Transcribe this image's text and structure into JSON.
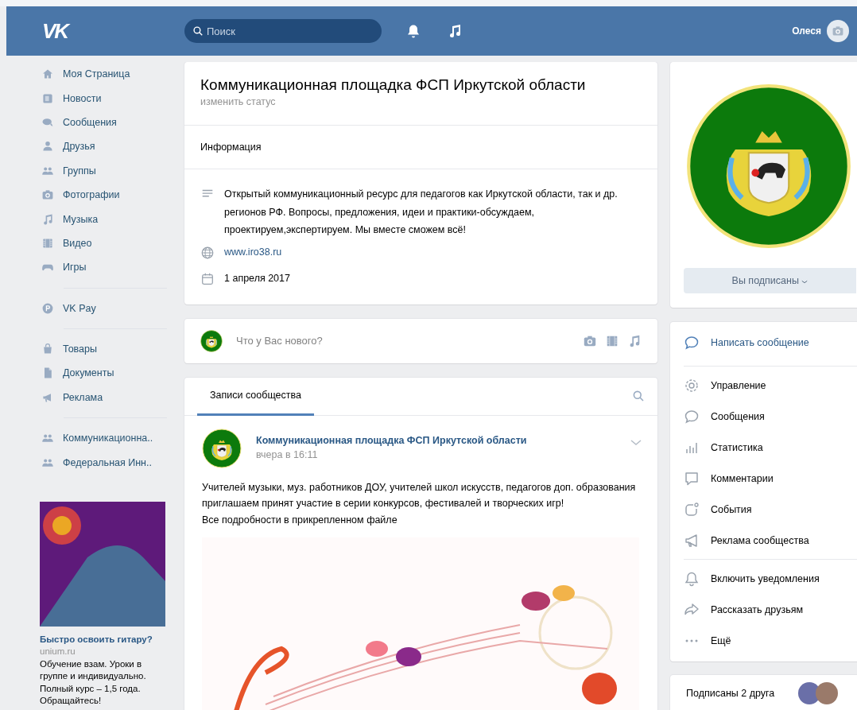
{
  "header": {
    "logo": "VK",
    "search": {
      "placeholder": "Поиск"
    },
    "user": "Олеся"
  },
  "sidebar": {
    "groups": [
      {
        "items": [
          {
            "label": "Моя Страница"
          },
          {
            "label": "Новости"
          },
          {
            "label": "Сообщения"
          },
          {
            "label": "Друзья"
          },
          {
            "label": "Группы"
          },
          {
            "label": "Фотографии"
          },
          {
            "label": "Музыка"
          },
          {
            "label": "Видео"
          },
          {
            "label": "Игры"
          }
        ]
      },
      {
        "items": [
          {
            "label": "VK Pay"
          }
        ]
      },
      {
        "items": [
          {
            "label": "Товары"
          },
          {
            "label": "Документы"
          },
          {
            "label": "Реклама"
          }
        ]
      },
      {
        "items": [
          {
            "label": "Коммуникационна.."
          },
          {
            "label": "Федеральная Инн.."
          }
        ]
      }
    ]
  },
  "ad": {
    "title": "Быстро освоить гитару?",
    "domain": "unium.ru",
    "text": "Обучение взам. Уроки в группе и индивидуально. Полный курс – 1,5 года. Обращайтесь!"
  },
  "community": {
    "title": "Коммуникационная площадка ФСП Иркутской области",
    "status": "изменить статус",
    "info_heading": "Информация",
    "description": "Открытый коммуникационный ресурс для педагогов как Иркутской области, так и др. регионов РФ. Вопросы, предложения, идеи и практики-обсуждаем, проектируем,экспертируем. Мы вместе сможем всё!",
    "link": "www.iro38.ru",
    "date": "1 апреля 2017"
  },
  "composer": {
    "placeholder": "Что у Вас нового?"
  },
  "wall": {
    "tabs": [
      {
        "label": "Записи сообщества",
        "selected": true
      }
    ],
    "post": {
      "author": "Коммуникационная площадка ФСП Иркутской области",
      "time": "вчера в 16:11",
      "paragraphs": [
        "Учителей музыки, муз. работников ДОУ, учителей школ искусств, педагогов доп. образования приглашаем принят участие в серии конкурсов, фестивалей и творческих игр!",
        "Все подробности в прикрепленном файле"
      ]
    }
  },
  "profile": {
    "subscribe_button": "Вы подписаны"
  },
  "actions": {
    "primary": "Написать сообщение",
    "groups": [
      {
        "items": [
          {
            "label": "Управление"
          },
          {
            "label": "Сообщения"
          },
          {
            "label": "Статистика"
          },
          {
            "label": "Комментарии"
          },
          {
            "label": "События"
          },
          {
            "label": "Реклама сообщества"
          }
        ]
      },
      {
        "items": [
          {
            "label": "Включить уведомления"
          },
          {
            "label": "Рассказать друзьям"
          },
          {
            "label": "Ещё"
          }
        ]
      }
    ]
  },
  "friends": {
    "label": "Подписаны 2 друга"
  }
}
